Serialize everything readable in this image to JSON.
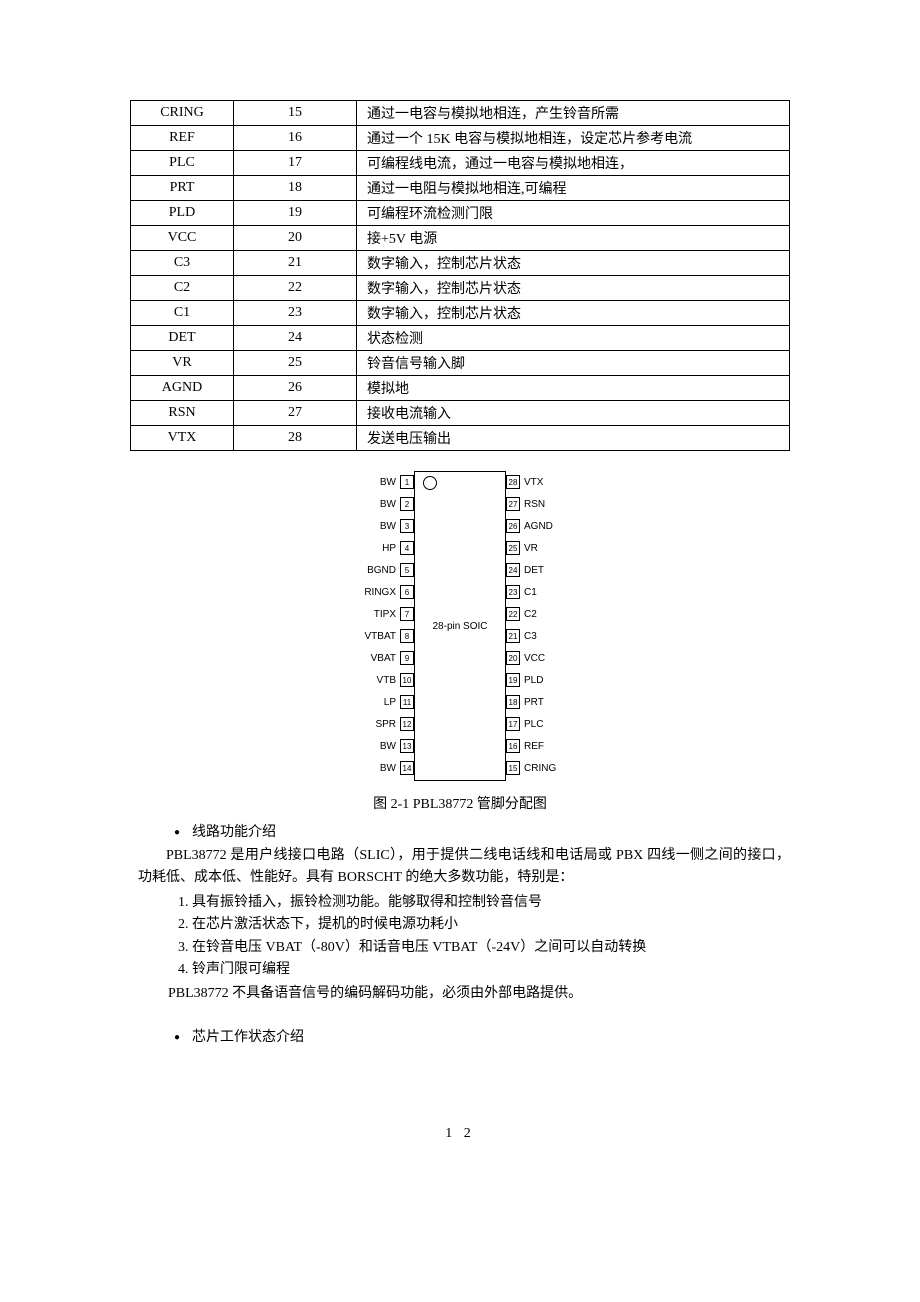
{
  "table_rows": [
    {
      "name": "CRING",
      "num": "15",
      "desc": "通过一电容与模拟地相连，产生铃音所需"
    },
    {
      "name": "REF",
      "num": "16",
      "desc": "通过一个 15K 电容与模拟地相连，设定芯片参考电流"
    },
    {
      "name": "PLC",
      "num": "17",
      "desc": "可编程线电流，通过一电容与模拟地相连，"
    },
    {
      "name": "PRT",
      "num": "18",
      "desc": "通过一电阻与模拟地相连,可编程"
    },
    {
      "name": "PLD",
      "num": "19",
      "desc": "可编程环流检测门限"
    },
    {
      "name": "VCC",
      "num": "20",
      "desc": "接+5V 电源"
    },
    {
      "name": "C3",
      "num": "21",
      "desc": "数字输入，控制芯片状态"
    },
    {
      "name": "C2",
      "num": "22",
      "desc": "数字输入，控制芯片状态"
    },
    {
      "name": "C1",
      "num": "23",
      "desc": "数字输入，控制芯片状态"
    },
    {
      "name": "DET",
      "num": "24",
      "desc": "状态检测"
    },
    {
      "name": "VR",
      "num": "25",
      "desc": "铃音信号输入脚"
    },
    {
      "name": "AGND",
      "num": "26",
      "desc": "模拟地"
    },
    {
      "name": "RSN",
      "num": "27",
      "desc": "接收电流输入"
    },
    {
      "name": "VTX",
      "num": "28",
      "desc": "发送电压输出"
    }
  ],
  "chip": {
    "body_label": "28-pin SOIC",
    "left_pins": [
      {
        "label": "BW",
        "n": "1"
      },
      {
        "label": "BW",
        "n": "2"
      },
      {
        "label": "BW",
        "n": "3"
      },
      {
        "label": "HP",
        "n": "4"
      },
      {
        "label": "BGND",
        "n": "5"
      },
      {
        "label": "RINGX",
        "n": "6"
      },
      {
        "label": "TIPX",
        "n": "7"
      },
      {
        "label": "VTBAT",
        "n": "8"
      },
      {
        "label": "VBAT",
        "n": "9"
      },
      {
        "label": "VTB",
        "n": "10"
      },
      {
        "label": "LP",
        "n": "11"
      },
      {
        "label": "SPR",
        "n": "12"
      },
      {
        "label": "BW",
        "n": "13"
      },
      {
        "label": "BW",
        "n": "14"
      }
    ],
    "right_pins": [
      {
        "label": "VTX",
        "n": "28"
      },
      {
        "label": "RSN",
        "n": "27"
      },
      {
        "label": "AGND",
        "n": "26"
      },
      {
        "label": "VR",
        "n": "25"
      },
      {
        "label": "DET",
        "n": "24"
      },
      {
        "label": "C1",
        "n": "23"
      },
      {
        "label": "C2",
        "n": "22"
      },
      {
        "label": "C3",
        "n": "21"
      },
      {
        "label": "VCC",
        "n": "20"
      },
      {
        "label": "PLD",
        "n": "19"
      },
      {
        "label": "PRT",
        "n": "18"
      },
      {
        "label": "PLC",
        "n": "17"
      },
      {
        "label": "REF",
        "n": "16"
      },
      {
        "label": "CRING",
        "n": "15"
      }
    ]
  },
  "figure_caption": "图 2-1   PBL38772 管脚分配图",
  "section1_title": "线路功能介绍",
  "para1": "PBL38772 是用户线接口电路（SLIC），用于提供二线电话线和电话局或 PBX 四线一侧之间的接口，功耗低、成本低、性能好。具有 BORSCHT 的绝大多数功能，特别是：",
  "list_items": [
    "具有振铃插入，振铃检测功能。能够取得和控制铃音信号",
    "在芯片激活状态下，提机的时候电源功耗小",
    "在铃音电压 VBAT（-80V）和话音电压 VTBAT（-24V）之间可以自动转换",
    "铃声门限可编程"
  ],
  "para2": "PBL38772 不具备语音信号的编码解码功能，必须由外部电路提供。",
  "section2_title": "芯片工作状态介绍",
  "page_number": "1 2"
}
